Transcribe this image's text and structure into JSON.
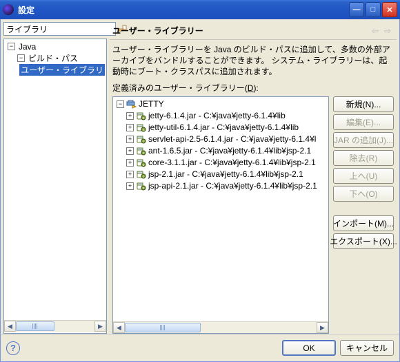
{
  "title": "設定",
  "filter": "ライブラリ",
  "nav_tree": {
    "root": "Java",
    "child": "ビルド・パス",
    "leaf": "ユーザー・ライブラリ"
  },
  "page": {
    "heading": "ユーザー・ライブラリー",
    "desc": "ユーザー・ライブラリーを Java のビルド・パスに追加して、多数の外部アーカイブをバンドルすることができます。 システム・ライブラリーは、起動時にブート・クラスパスに追加されます。",
    "list_label_pre": "定義済みのユーザー・ライブラリー(",
    "list_label_u": "D",
    "list_label_post": "):"
  },
  "library": {
    "name": "JETTY",
    "jars": [
      "jetty-6.1.4.jar - C:¥java¥jetty-6.1.4¥lib",
      "jetty-util-6.1.4.jar - C:¥java¥jetty-6.1.4¥lib",
      "servlet-api-2.5-6.1.4.jar - C:¥java¥jetty-6.1.4¥l",
      "ant-1.6.5.jar - C:¥java¥jetty-6.1.4¥lib¥jsp-2.1",
      "core-3.1.1.jar - C:¥java¥jetty-6.1.4¥lib¥jsp-2.1",
      "jsp-2.1.jar - C:¥java¥jetty-6.1.4¥lib¥jsp-2.1",
      "jsp-api-2.1.jar - C:¥java¥jetty-6.1.4¥lib¥jsp-2.1"
    ]
  },
  "buttons": {
    "new": "新規(N)...",
    "edit": "編集(E)...",
    "addjar": "JAR の追加(J)...",
    "remove": "除去(R)",
    "up": "上へ(U)",
    "down": "下へ(O)",
    "import": "インポート(M)...",
    "export": "エクスポート(X)...",
    "ok": "OK",
    "cancel": "キャンセル"
  }
}
